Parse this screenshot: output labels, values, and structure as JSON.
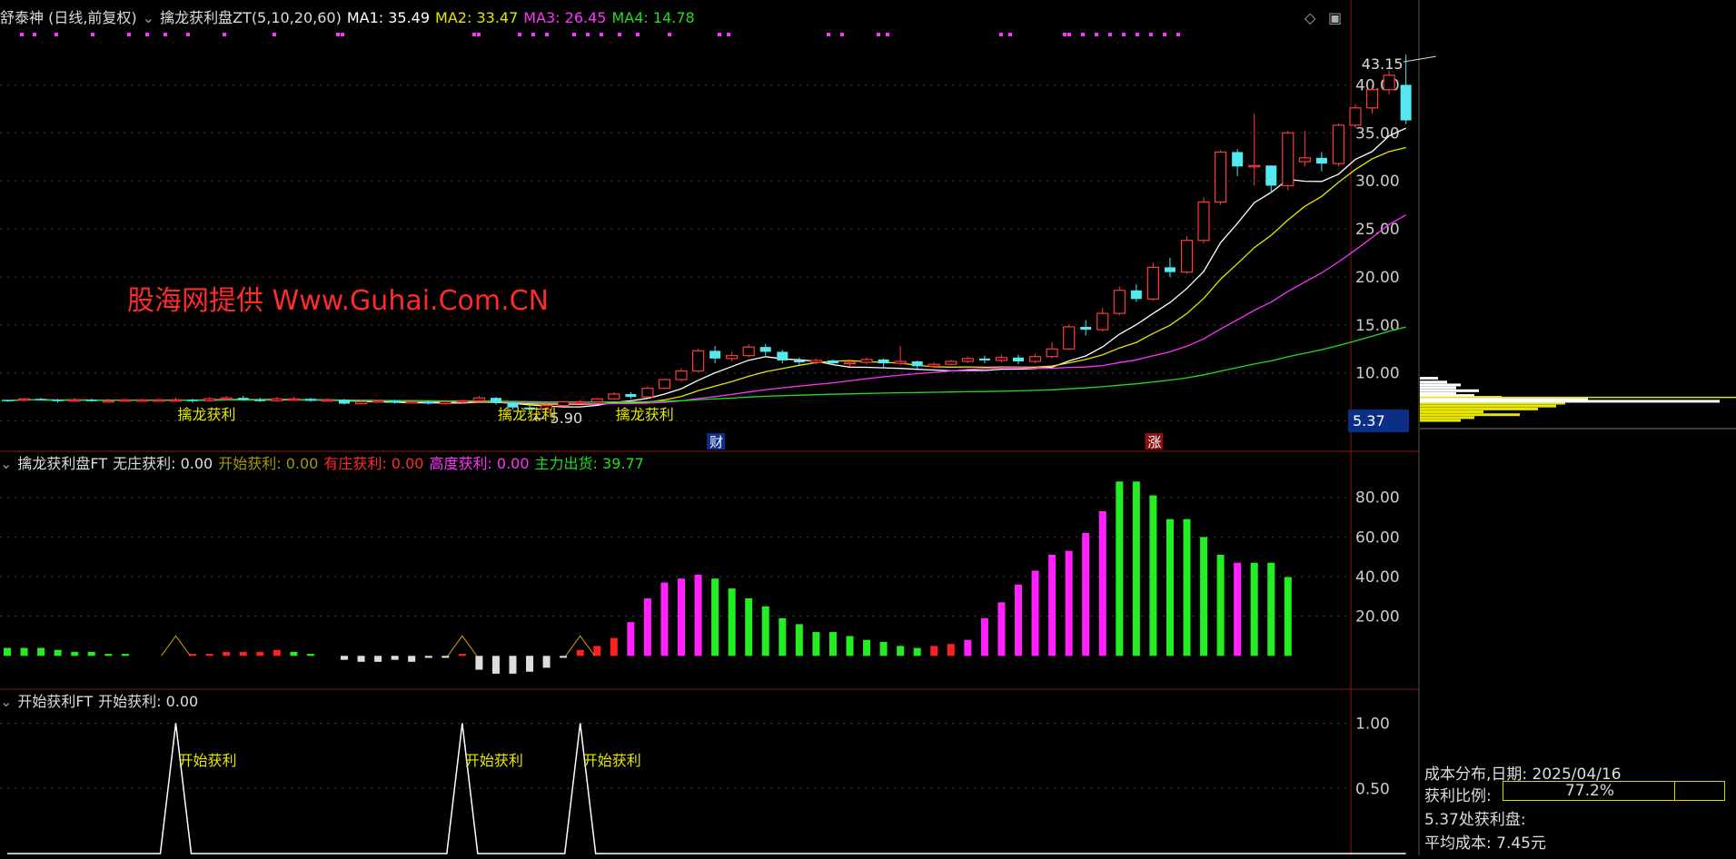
{
  "header": {
    "stock": "舒泰神 (日线,前复权)",
    "indicator": "擒龙获利盘ZT(5,10,20,60)",
    "ma": [
      {
        "label": "MA1: 35.49",
        "color": "#ffffff"
      },
      {
        "label": "MA2: 33.47",
        "color": "#e6e600"
      },
      {
        "label": "MA3: 26.45",
        "color": "#ff33ff"
      },
      {
        "label": "MA4: 14.78",
        "color": "#22dd22"
      }
    ]
  },
  "panel2_header": {
    "indicator": "擒龙获利盘FT",
    "items": [
      {
        "label": "无庄获利: 0.00",
        "color": "#dddddd"
      },
      {
        "label": "开始获利: 0.00",
        "color": "#a09a00"
      },
      {
        "label": "有庄获利: 0.00",
        "color": "#ff2a2a"
      },
      {
        "label": "高度获利: 0.00",
        "color": "#ff33ff"
      },
      {
        "label": "主力出货: 39.77",
        "color": "#22dd22"
      }
    ]
  },
  "panel3_header": {
    "indicator": "开始获利FT",
    "items": [
      {
        "label": "开始获利: 0.00",
        "color": "#dddddd"
      }
    ]
  },
  "watermark": "股海网提供 Www.Guhai.Com.CN",
  "annotations": {
    "qinlong": "擒龙获利",
    "kaishi": "开始获利",
    "high": "43.15",
    "low": "5.90",
    "badge_cai": "财",
    "badge_zhang": "涨"
  },
  "cost_panel": {
    "title": "成本分布,日期:",
    "date": "2025/04/16",
    "ratio_label": "获利比例:",
    "ratio_text": "77.2%",
    "ratio": 0.772,
    "profit_line": "5.37处获利盘:",
    "avg_label": "平均成本:",
    "avg_value": "7.45元",
    "current_price": "5.37"
  },
  "chart_data": [
    {
      "type": "candlestick",
      "ylim": [
        2.5,
        46
      ],
      "yticks": [
        "5.00",
        "10.00",
        "15.00",
        "20.00",
        "25.00",
        "30.00",
        "35.00",
        "40.00"
      ],
      "candles": [
        [
          7.2,
          7.1,
          7.0,
          7.2
        ],
        [
          7.2,
          7.3,
          7.0,
          7.4
        ],
        [
          7.3,
          7.2,
          7.1,
          7.4
        ],
        [
          7.2,
          7.1,
          6.9,
          7.3
        ],
        [
          7.1,
          7.2,
          7.0,
          7.4
        ],
        [
          7.2,
          7.1,
          7.0,
          7.3
        ],
        [
          7.1,
          7.1,
          6.9,
          7.3
        ],
        [
          7.1,
          7.2,
          7.0,
          7.3
        ],
        [
          7.2,
          7.2,
          7.1,
          7.3
        ],
        [
          7.2,
          7.2,
          7.1,
          7.3
        ],
        [
          7.2,
          7.2,
          7.0,
          7.4
        ],
        [
          7.2,
          7.1,
          6.9,
          7.3
        ],
        [
          7.1,
          7.3,
          7.0,
          7.5
        ],
        [
          7.3,
          7.4,
          7.2,
          7.6
        ],
        [
          7.4,
          7.2,
          7.1,
          7.6
        ],
        [
          7.2,
          7.1,
          7.0,
          7.4
        ],
        [
          7.1,
          7.3,
          7.0,
          7.5
        ],
        [
          7.3,
          7.3,
          7.1,
          7.5
        ],
        [
          7.3,
          7.1,
          7.0,
          7.4
        ],
        [
          7.1,
          7.2,
          7.0,
          7.3
        ],
        [
          7.2,
          6.8,
          6.7,
          7.3
        ],
        [
          6.8,
          7.0,
          6.7,
          7.2
        ],
        [
          7.0,
          7.1,
          6.9,
          7.2
        ],
        [
          7.1,
          6.9,
          6.8,
          7.2
        ],
        [
          6.9,
          7.0,
          6.8,
          7.1
        ],
        [
          7.0,
          6.8,
          6.7,
          7.1
        ],
        [
          6.8,
          7.0,
          6.7,
          7.2
        ],
        [
          7.0,
          7.1,
          6.8,
          7.2
        ],
        [
          7.1,
          7.4,
          7.0,
          7.6
        ],
        [
          7.4,
          6.9,
          6.7,
          7.5
        ],
        [
          6.9,
          6.4,
          6.2,
          7.0
        ],
        [
          6.4,
          6.2,
          5.9,
          6.6
        ],
        [
          6.2,
          6.6,
          6.1,
          6.8
        ],
        [
          6.6,
          7.0,
          6.5,
          7.1
        ],
        [
          7.0,
          7.0,
          6.8,
          7.2
        ],
        [
          7.0,
          7.3,
          6.9,
          7.4
        ],
        [
          7.3,
          7.8,
          7.2,
          8.0
        ],
        [
          7.8,
          7.5,
          7.3,
          8.0
        ],
        [
          7.5,
          8.4,
          7.4,
          8.6
        ],
        [
          8.4,
          9.3,
          8.3,
          9.4
        ],
        [
          9.3,
          10.2,
          9.1,
          10.5
        ],
        [
          10.2,
          12.3,
          10.1,
          12.5
        ],
        [
          12.3,
          11.5,
          11.0,
          12.8
        ],
        [
          11.5,
          11.8,
          11.2,
          12.2
        ],
        [
          11.8,
          12.7,
          11.6,
          13.0
        ],
        [
          12.7,
          12.2,
          11.8,
          13.0
        ],
        [
          12.2,
          11.3,
          11.0,
          12.4
        ],
        [
          11.3,
          11.1,
          10.8,
          11.6
        ],
        [
          11.1,
          11.3,
          10.9,
          11.5
        ],
        [
          11.3,
          11.0,
          10.8,
          11.4
        ],
        [
          11.0,
          11.1,
          10.7,
          11.4
        ],
        [
          11.1,
          11.4,
          10.9,
          11.6
        ],
        [
          11.4,
          11.0,
          10.6,
          11.5
        ],
        [
          11.0,
          11.2,
          10.8,
          12.8
        ],
        [
          11.2,
          10.7,
          10.4,
          11.3
        ],
        [
          10.7,
          10.9,
          10.5,
          11.1
        ],
        [
          10.9,
          11.2,
          10.8,
          11.4
        ],
        [
          11.2,
          11.5,
          11.0,
          11.7
        ],
        [
          11.5,
          11.3,
          11.0,
          11.8
        ],
        [
          11.3,
          11.6,
          11.1,
          11.9
        ],
        [
          11.6,
          11.2,
          10.9,
          11.9
        ],
        [
          11.2,
          11.7,
          11.0,
          12.0
        ],
        [
          11.7,
          12.5,
          11.5,
          13.2
        ],
        [
          12.5,
          14.8,
          12.4,
          15.0
        ],
        [
          14.8,
          14.5,
          13.9,
          15.5
        ],
        [
          14.5,
          16.2,
          14.3,
          16.8
        ],
        [
          16.2,
          18.6,
          16.0,
          19.0
        ],
        [
          18.6,
          17.7,
          17.4,
          19.2
        ],
        [
          17.7,
          21.0,
          17.5,
          21.5
        ],
        [
          21.0,
          20.5,
          20.0,
          22.0
        ],
        [
          20.5,
          23.8,
          20.3,
          24.2
        ],
        [
          23.8,
          27.8,
          23.5,
          28.3
        ],
        [
          27.8,
          33.0,
          27.5,
          33.2
        ],
        [
          33.0,
          31.5,
          30.5,
          33.3
        ],
        [
          31.5,
          31.6,
          29.5,
          37.0
        ],
        [
          31.6,
          29.5,
          28.8,
          31.6
        ],
        [
          29.5,
          35.0,
          29.0,
          35.2
        ],
        [
          32.0,
          32.4,
          31.5,
          35.2
        ],
        [
          32.4,
          31.8,
          31.0,
          33.0
        ],
        [
          31.8,
          35.8,
          31.5,
          36.0
        ],
        [
          35.8,
          37.6,
          35.5,
          38.0
        ],
        [
          37.6,
          39.5,
          37.0,
          40.0
        ],
        [
          39.5,
          41.0,
          39.0,
          41.5
        ],
        [
          40.0,
          36.3,
          35.9,
          43.15
        ]
      ],
      "ma_windows": [
        5,
        10,
        20,
        60
      ],
      "ma_last": [
        35.49,
        33.47,
        26.45,
        14.78
      ],
      "signal_days": [
        10,
        29,
        36
      ],
      "high": {
        "day": 85,
        "value": 43.15
      },
      "low": {
        "day": 31,
        "value": 5.9
      }
    },
    {
      "type": "bar",
      "ylim": [
        -15,
        95
      ],
      "yticks": [
        "20.00",
        "40.00",
        "60.00",
        "80.00"
      ],
      "series": [
        {
          "name": "无庄获利",
          "color": "#dddddd",
          "points": [
            [
              20,
              -2
            ],
            [
              21,
              -3
            ],
            [
              22,
              -3
            ],
            [
              23,
              -2
            ],
            [
              24,
              -3
            ],
            [
              25,
              -1
            ],
            [
              26,
              -1
            ],
            [
              28,
              -7
            ],
            [
              29,
              -9
            ],
            [
              30,
              -9
            ],
            [
              31,
              -8
            ],
            [
              32,
              -6
            ],
            [
              33,
              -1
            ]
          ]
        },
        {
          "name": "有庄获利",
          "color": "#ff2020",
          "points": [
            [
              11,
              1
            ],
            [
              12,
              1
            ],
            [
              13,
              2
            ],
            [
              14,
              2
            ],
            [
              15,
              2
            ],
            [
              16,
              3
            ],
            [
              27,
              1
            ],
            [
              34,
              3
            ],
            [
              35,
              5
            ],
            [
              36,
              9
            ],
            [
              55,
              5
            ],
            [
              56,
              6
            ]
          ]
        },
        {
          "name": "高度获利",
          "color": "#ff22ff",
          "points": [
            [
              37,
              17
            ],
            [
              38,
              29
            ],
            [
              39,
              37
            ],
            [
              40,
              39
            ],
            [
              41,
              41
            ],
            [
              57,
              8
            ],
            [
              58,
              19
            ],
            [
              59,
              27
            ],
            [
              60,
              36
            ],
            [
              61,
              43
            ],
            [
              62,
              51
            ],
            [
              63,
              53
            ],
            [
              64,
              62
            ],
            [
              65,
              73
            ],
            [
              73,
              47
            ]
          ]
        },
        {
          "name": "主力出货",
          "color": "#22ee22",
          "points": [
            [
              0,
              4
            ],
            [
              1,
              4
            ],
            [
              2,
              4
            ],
            [
              3,
              3
            ],
            [
              4,
              2
            ],
            [
              5,
              2
            ],
            [
              6,
              1
            ],
            [
              7,
              1
            ],
            [
              17,
              2
            ],
            [
              18,
              1
            ],
            [
              42,
              39
            ],
            [
              43,
              34
            ],
            [
              44,
              29
            ],
            [
              45,
              25
            ],
            [
              46,
              19
            ],
            [
              47,
              16
            ],
            [
              48,
              12
            ],
            [
              49,
              12
            ],
            [
              50,
              10
            ],
            [
              51,
              8
            ],
            [
              52,
              7
            ],
            [
              53,
              5
            ],
            [
              54,
              4
            ],
            [
              66,
              88
            ],
            [
              67,
              88
            ],
            [
              68,
              81
            ],
            [
              69,
              69
            ],
            [
              70,
              69
            ],
            [
              71,
              60
            ],
            [
              72,
              51
            ],
            [
              74,
              47
            ],
            [
              75,
              47
            ],
            [
              76,
              39.77
            ]
          ]
        }
      ],
      "signal_days": [
        10,
        27,
        34
      ]
    },
    {
      "type": "line",
      "ylim": [
        0,
        1.15
      ],
      "yticks": [
        "0.50",
        "1.00"
      ],
      "spikes": [
        10,
        27,
        34
      ]
    }
  ]
}
